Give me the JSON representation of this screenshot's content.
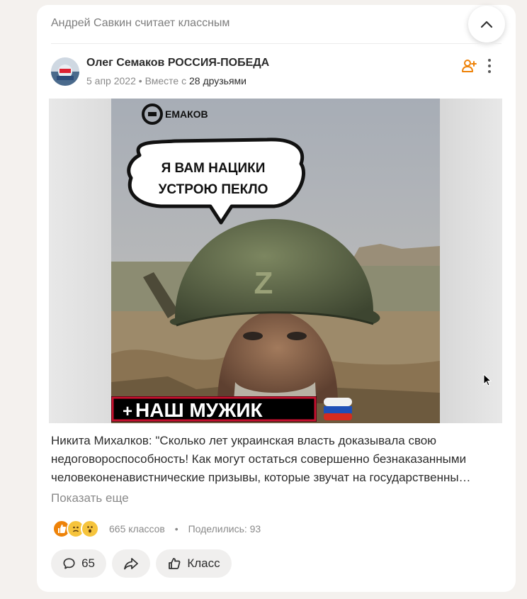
{
  "feed": {
    "reason": "Андрей Савкин считает классным",
    "collapse_icon": "chevron-up-icon"
  },
  "post": {
    "author": "Олег Семаков РОССИЯ-ПОБЕДА",
    "date": "5 апр 2022",
    "together_prefix": "Вместе с",
    "friends": "28 друзьями",
    "image": {
      "logo_text": "ЕМАКОВ",
      "speech_line1": "Я ВАМ НАЦИКИ",
      "speech_line2": "УСТРОЮ ПЕКЛО",
      "helmet_mark": "Z",
      "banner_text": "НАШ МУЖИК",
      "banner_plus": "+"
    },
    "text_lines": [
      "Никита Михалков: \"Сколько лет украинская власть доказывала свою",
      "недоговороспособность! Как могут остаться совершенно безнаказанными",
      "человеконенавистнические призывы, которые звучат на государственны…"
    ],
    "show_more": "Показать еще",
    "classes": "665 классов",
    "shared": "Поделились: 93",
    "comments_count": "65",
    "class_label": "Класс"
  },
  "colors": {
    "accent": "#ee8208",
    "background": "#f4f1ee",
    "card": "#ffffff"
  }
}
